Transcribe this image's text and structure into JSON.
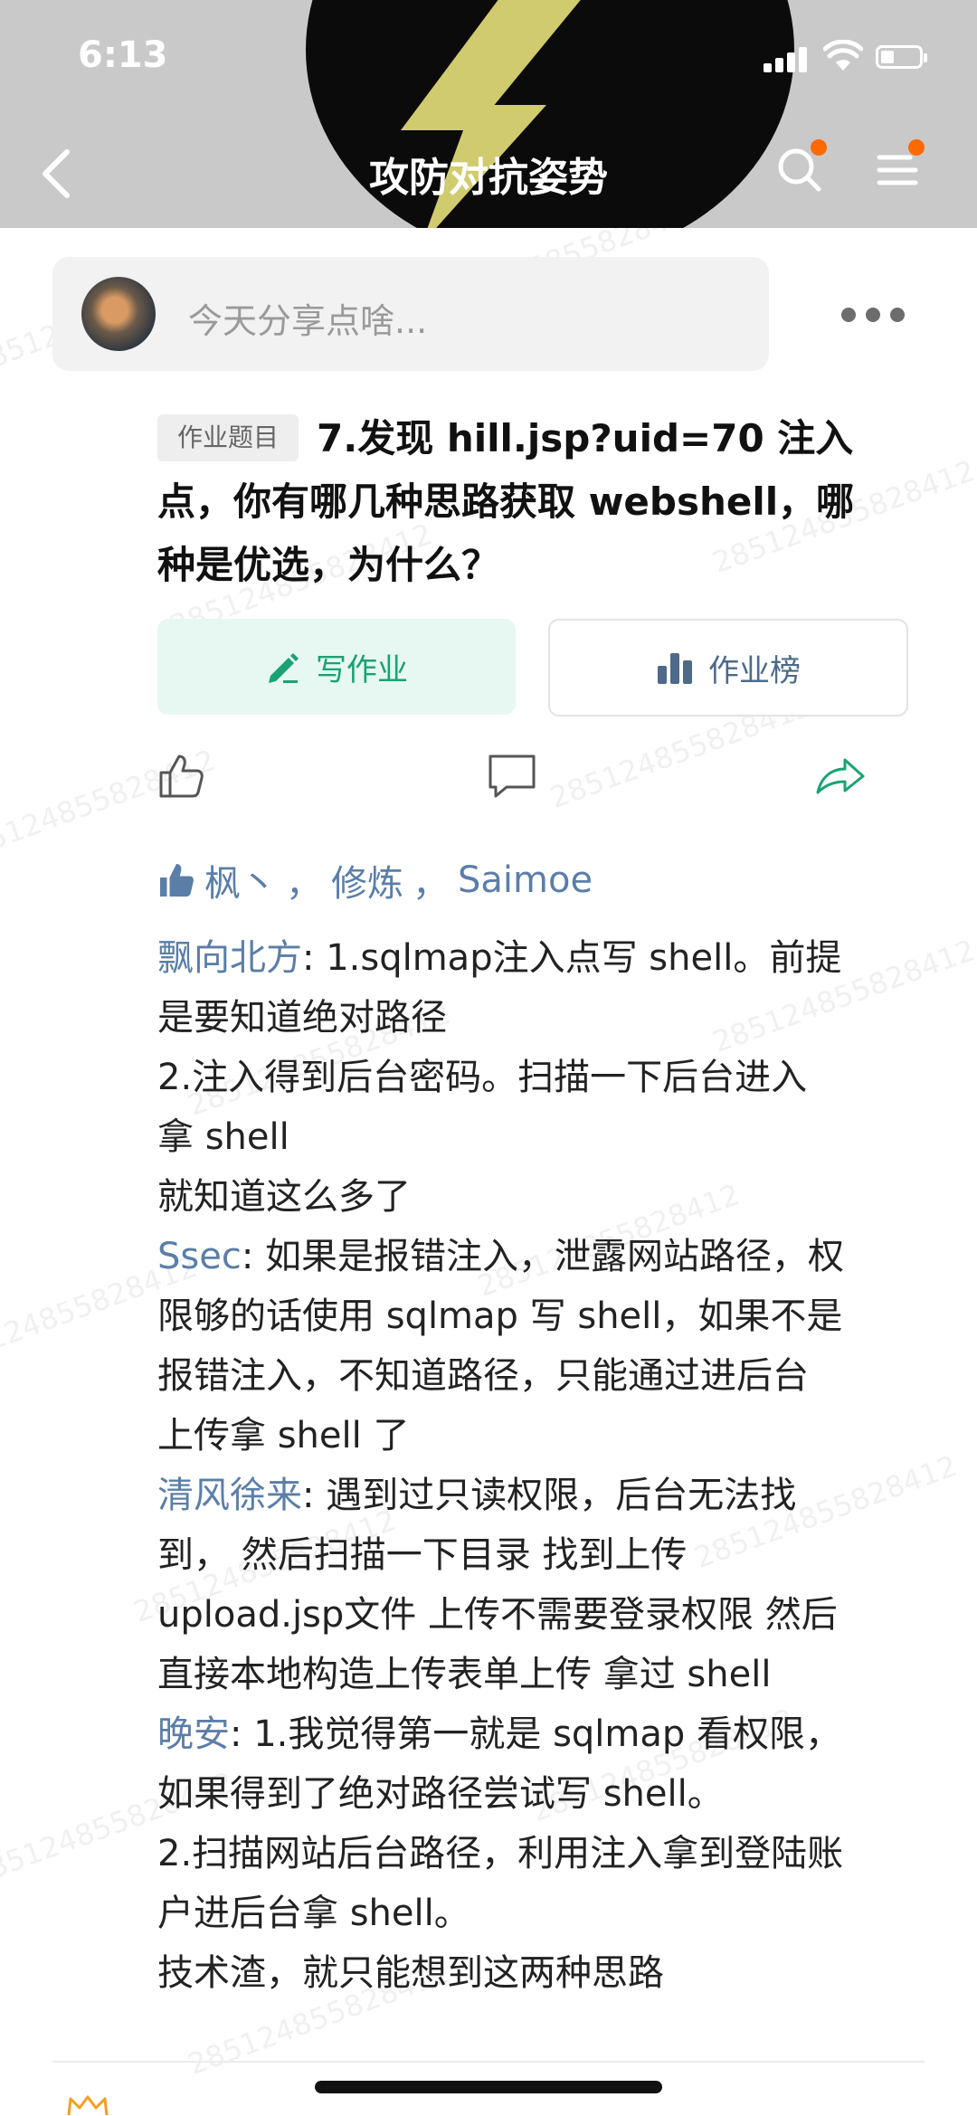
{
  "status_bar": {
    "time": "6:13"
  },
  "header": {
    "title": "攻防对抗姿势"
  },
  "composer": {
    "placeholder": "今天分享点啥..."
  },
  "watermark": {
    "text": "285124855828412"
  },
  "post": {
    "tag": "作业题目",
    "question_lines": [
      "7.发现 hill.jsp?uid=70 注入",
      "点，你有哪几种思路获取 webshell，哪",
      "种是优选，为什么？"
    ],
    "write_label": "写作业",
    "rank_label": "作业榜"
  },
  "likes": {
    "names": [
      "枫丶",
      "修炼",
      "Saimoe"
    ],
    "separator": "，"
  },
  "comments": [
    {
      "author": "飘向北方",
      "lines": [
        "1.sqlmap注入点写 shell。前提",
        "是要知道绝对路径",
        "2.注入得到后台密码。扫描一下后台进入",
        "拿 shell",
        "就知道这么多了"
      ]
    },
    {
      "author": "Ssec",
      "lines": [
        "如果是报错注入，泄露网站路径，权",
        "限够的话使用 sqlmap 写 shell，如果不是",
        "报错注入，不知道路径，只能通过进后台",
        "上传拿 shell 了"
      ]
    },
    {
      "author": "清风徐来",
      "lines": [
        "遇到过只读权限，后台无法找",
        "到， 然后扫描一下目录 找到上传",
        "upload.jsp文件 上传不需要登录权限 然后",
        "直接本地构造上传表单上传 拿过 shell"
      ]
    },
    {
      "author": "晚安",
      "lines": [
        "1.我觉得第一就是 sqlmap 看权限，",
        "如果得到了绝对路径尝试写 shell。",
        "2.扫描网站后台路径，利用注入拿到登陆账",
        "户进后台拿 shell。",
        "技术渣，就只能想到这两种思路"
      ]
    }
  ],
  "colors": {
    "accent_green": "#1aa274",
    "link_blue": "#5b7ea8",
    "badge_orange": "#ff6a00"
  }
}
